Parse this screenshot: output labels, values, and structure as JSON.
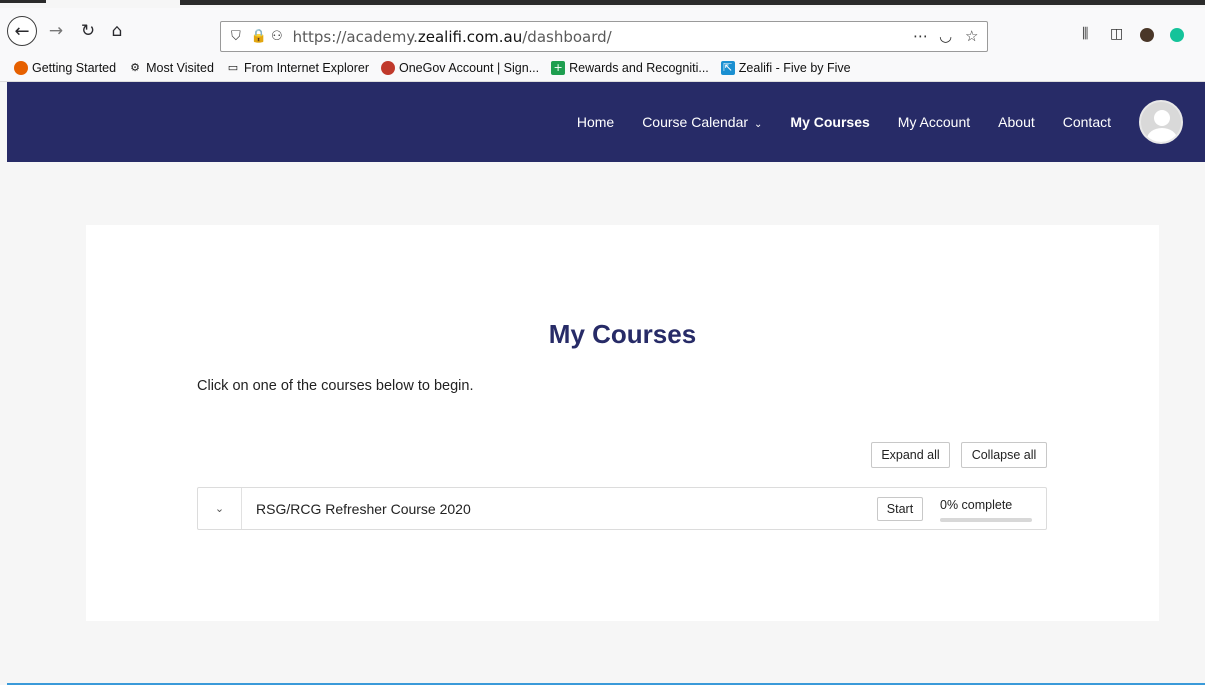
{
  "browser": {
    "url_prefix": "https://academy.",
    "url_domain": "zealifi.com.au",
    "url_path": "/dashboard/",
    "icons": {
      "back": "back-arrow-icon",
      "forward": "forward-arrow-icon",
      "reload": "reload-icon",
      "home": "home-icon",
      "shield": "shield-icon",
      "lock": "lock-icon",
      "permissions": "permissions-icon",
      "more": "ellipsis-icon",
      "pocket": "pocket-icon",
      "star": "star-icon",
      "library": "library-icon",
      "sidebar": "sidebar-icon",
      "extension": "extension-icon",
      "grammarly": "grammarly-icon"
    }
  },
  "bookmarks": [
    {
      "label": "Getting Started",
      "icon": "firefox-icon"
    },
    {
      "label": "Most Visited",
      "icon": "gear-icon"
    },
    {
      "label": "From Internet Explorer",
      "icon": "folder-icon"
    },
    {
      "label": "OneGov Account | Sign...",
      "icon": "onegov-icon"
    },
    {
      "label": "Rewards and Recogniti...",
      "icon": "plus-icon"
    },
    {
      "label": "Zealifi - Five by Five",
      "icon": "zealifi-icon"
    }
  ],
  "site_nav": {
    "items": [
      "Home",
      "Course Calendar",
      "My Courses",
      "My Account",
      "About",
      "Contact"
    ],
    "active": "My Courses",
    "avatar": "user-avatar-icon"
  },
  "main": {
    "title": "My Courses",
    "intro": "Click on one of the courses below to begin.",
    "expand_all": "Expand all",
    "collapse_all": "Collapse all",
    "courses": [
      {
        "title": "RSG/RCG Refresher Course 2020",
        "start_label": "Start",
        "progress_label": "0% complete",
        "progress": 0
      }
    ]
  },
  "colors": {
    "header_bg": "#272b67",
    "title": "#272b67"
  }
}
